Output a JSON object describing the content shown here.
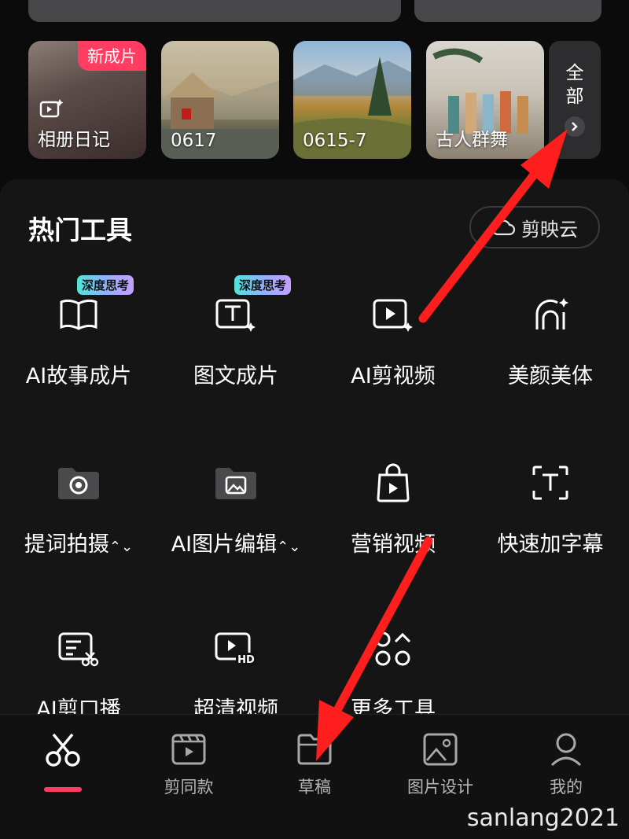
{
  "albums": [
    {
      "label": "相册日记",
      "badge": "新成片"
    },
    {
      "label": "0617"
    },
    {
      "label": "0615-7"
    },
    {
      "label": "古人群舞"
    }
  ],
  "albums_more": "全部",
  "hot_tools": {
    "title": "热门工具",
    "cloud_button": "剪映云",
    "items": [
      {
        "label": "AI故事成片",
        "badge": "深度思考",
        "icon": "book-icon"
      },
      {
        "label": "图文成片",
        "badge": "深度思考",
        "icon": "text-image-icon"
      },
      {
        "label": "AI剪视频",
        "icon": "ai-video-icon"
      },
      {
        "label": "美颜美体",
        "icon": "beauty-icon"
      },
      {
        "label": "提词拍摄",
        "icon": "camera-folder-icon"
      },
      {
        "label": "AI图片编辑",
        "icon": "image-folder-icon"
      },
      {
        "label": "营销视频",
        "icon": "shopping-bag-icon"
      },
      {
        "label": "快速加字幕",
        "icon": "caption-icon"
      },
      {
        "label": "AI剪口播",
        "icon": "speech-cut-icon"
      },
      {
        "label": "超清视频",
        "icon": "hd-video-icon"
      },
      {
        "label": "更多工具",
        "icon": "more-tools-icon"
      }
    ]
  },
  "tabbar": {
    "items": [
      {
        "label": "",
        "icon": "scissors-icon",
        "active": true
      },
      {
        "label": "剪同款",
        "icon": "clapper-icon"
      },
      {
        "label": "草稿",
        "icon": "folder-icon"
      },
      {
        "label": "图片设计",
        "icon": "picture-icon"
      },
      {
        "label": "我的",
        "icon": "user-icon"
      }
    ]
  },
  "watermark": "sanlang2021",
  "colors": {
    "accent": "#ff3d63",
    "annotation_arrow": "#ff1e1e",
    "panel": "#151515"
  }
}
